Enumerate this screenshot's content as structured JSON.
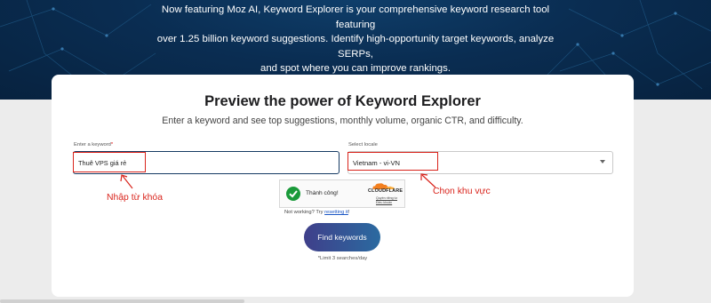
{
  "hero": {
    "line1": "Now featuring Moz AI, Keyword Explorer is your comprehensive keyword research tool featuring",
    "line2": "over 1.25 billion keyword suggestions. Identify high-opportunity target keywords, analyze SERPs,",
    "line3": "and spot where you can improve rankings."
  },
  "card": {
    "title": "Preview the power of Keyword Explorer",
    "subtitle": "Enter a keyword and see top suggestions, monthly volume, organic CTR, and difficulty."
  },
  "keyword": {
    "label": "Enter a keyword",
    "required_mark": "*",
    "value": "Thuê VPS giá rẻ"
  },
  "locale": {
    "label": "Select locale",
    "selected": "Vietnam - vi-VN"
  },
  "annotations": {
    "keyword_note": "Nhập từ khóa",
    "locale_note": "Chọn khu vực",
    "color": "#d9241c"
  },
  "captcha": {
    "status": "Thành công!",
    "brand": "CLOUDFLARE",
    "privacy_link": "Quyền riêng tư",
    "terms_link": "Điều khoản",
    "not_working": "Not working? Try",
    "reset_link": "resetting it",
    "reset_suffix": "!"
  },
  "action": {
    "button": "Find keywords",
    "limit": "*Limit 3 searches/day"
  },
  "colors": {
    "hero_bg": "#0a2d52",
    "button_start": "#3f3f8a",
    "button_end": "#2b6aa0",
    "success": "#1a9a3a"
  }
}
